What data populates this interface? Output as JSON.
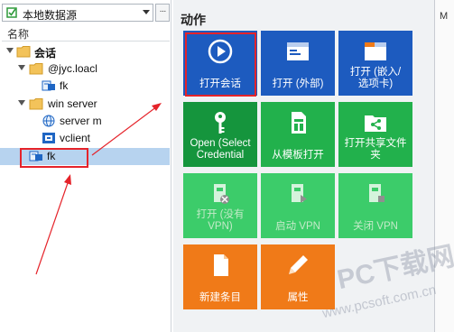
{
  "datasource": {
    "label": "本地数据源",
    "more": "···"
  },
  "tree": {
    "header": "名称",
    "nodes": [
      {
        "label": "会话",
        "bold": true
      },
      {
        "label": "@jyc.loacl"
      },
      {
        "label": "fk"
      },
      {
        "label": "win server"
      },
      {
        "label": "server m"
      },
      {
        "label": "vclient"
      },
      {
        "label": "fk",
        "selected": true
      }
    ]
  },
  "actions": {
    "title": "动作",
    "tiles": [
      {
        "label": "打开会话",
        "icon": "play-circle-icon",
        "color": "blue"
      },
      {
        "label": "打开 (外部)",
        "icon": "window-icon",
        "color": "blue"
      },
      {
        "label": "打开 (嵌入/\n选项卡)",
        "icon": "window-tab-icon",
        "color": "blue"
      },
      {
        "label": "Open (Select\nCredential",
        "icon": "key-icon",
        "color": "dgreen"
      },
      {
        "label": "从模板打开",
        "icon": "template-doc-icon",
        "color": "green"
      },
      {
        "label": "打开共享文件\n夹",
        "icon": "shared-folder-icon",
        "color": "green"
      },
      {
        "label": "打开 (没有\nVPN)",
        "icon": "vpn-block-icon",
        "color": "lgreen",
        "dim": true
      },
      {
        "label": "启动 VPN",
        "icon": "vpn-start-icon",
        "color": "lgreen",
        "dim": true
      },
      {
        "label": "关闭 VPN",
        "icon": "vpn-stop-icon",
        "color": "lgreen",
        "dim": true
      },
      {
        "label": "新建条目",
        "icon": "new-entry-icon",
        "color": "orange"
      },
      {
        "label": "属性",
        "icon": "pencil-icon",
        "color": "orange"
      }
    ]
  },
  "right_edge": {
    "label": "M"
  },
  "watermark": {
    "main": "PC下载网",
    "url": "www.pcsoft.com.cn"
  },
  "colors": {
    "blue": "#1d5bbf",
    "dgreen": "#15953d",
    "green": "#22b14c",
    "lgreen": "#3ccc6a",
    "orange": "#f07a18",
    "annotation_red": "#e5232a",
    "selection": "#b7d3ef"
  }
}
